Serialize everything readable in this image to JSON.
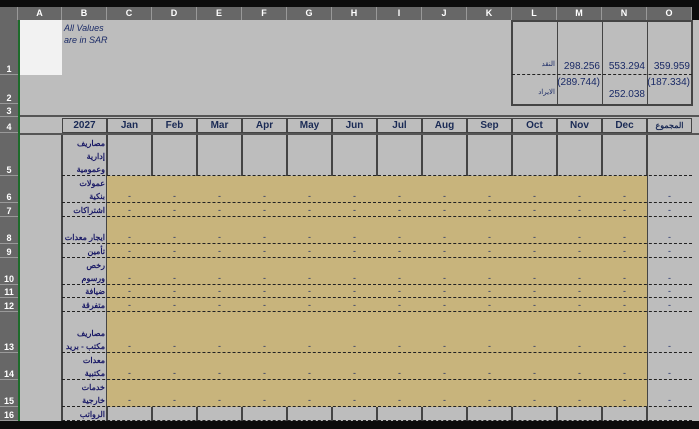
{
  "columns": [
    "A",
    "B",
    "C",
    "D",
    "E",
    "F",
    "G",
    "H",
    "I",
    "J",
    "K",
    "L",
    "M",
    "N",
    "O"
  ],
  "rows": [
    "1",
    "2",
    "3",
    "4",
    "5",
    "6",
    "7",
    "8",
    "9",
    "10",
    "11",
    "12",
    "13",
    "14",
    "15",
    "16"
  ],
  "note": "All Values are in SAR",
  "summary": {
    "row1": {
      "label": "النقد",
      "M": "298.256",
      "N": "553.294",
      "O": "359.959"
    },
    "row2": {
      "label": "الايراد",
      "M": "(289.744)",
      "N": "252.038",
      "O": "(187.334)"
    }
  },
  "header": {
    "year": "2027",
    "months": [
      "Jan",
      "Feb",
      "Mar",
      "Apr",
      "May",
      "Jun",
      "Jul",
      "Aug",
      "Sep",
      "Oct",
      "Nov",
      "Dec"
    ],
    "total": "المجموع"
  },
  "items": [
    {
      "row": "5",
      "label": "مصاريف إدارية وعمومية",
      "value": ""
    },
    {
      "row": "6",
      "label": "عمولات بنكية",
      "value": "-"
    },
    {
      "row": "7",
      "label": "اشتراكات",
      "value": "-"
    },
    {
      "row": "8",
      "label": "ايجار معدات",
      "value": "-"
    },
    {
      "row": "9",
      "label": "تأمين",
      "value": "-"
    },
    {
      "row": "10",
      "label": "رخص ورسوم",
      "value": "-"
    },
    {
      "row": "11",
      "label": "ضيافة",
      "value": "-"
    },
    {
      "row": "12",
      "label": "متفرقة",
      "value": "-"
    },
    {
      "row": "13",
      "label": "مصاريف مكتب - بريد",
      "value": "-"
    },
    {
      "row": "14",
      "label": "معدات مكتبية",
      "value": "-"
    },
    {
      "row": "15",
      "label": "خدمات خارجية",
      "value": "-"
    },
    {
      "row": "16",
      "label": "الرواتب",
      "value": ""
    }
  ]
}
